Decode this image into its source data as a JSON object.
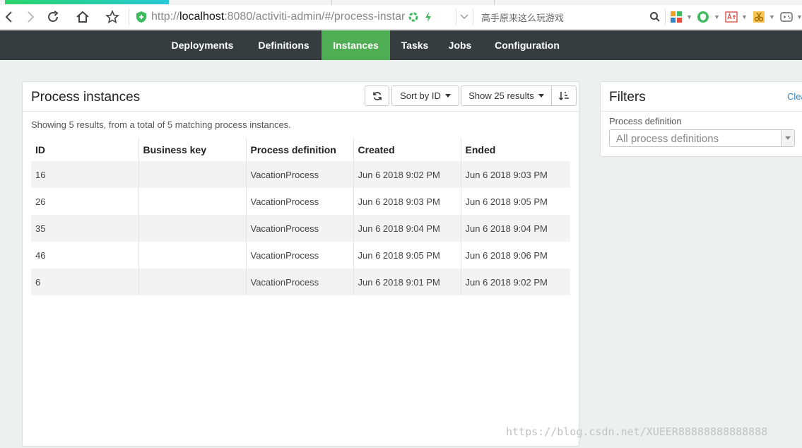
{
  "browser": {
    "url_scheme": "http://",
    "url_host": "localhost",
    "url_rest": ":8080/activiti-admin/#/process-instar",
    "search_hint": "高手原来这么玩游戏"
  },
  "nav": {
    "items": [
      {
        "label": "Deployments"
      },
      {
        "label": "Definitions"
      },
      {
        "label": "Instances"
      },
      {
        "label": "Tasks"
      },
      {
        "label": "Jobs"
      },
      {
        "label": "Configuration"
      }
    ],
    "active": "Instances"
  },
  "panel": {
    "title": "Process instances",
    "sort_label": "Sort by ID",
    "show_label": "Show 25 results",
    "summary": "Showing 5 results, from a total of 5 matching process instances.",
    "columns": [
      "ID",
      "Business key",
      "Process definition",
      "Created",
      "Ended"
    ],
    "rows": [
      {
        "id": "16",
        "business_key": "",
        "definition": "VacationProcess",
        "created": "Jun 6 2018 9:02 PM",
        "ended": "Jun 6 2018 9:03 PM"
      },
      {
        "id": "26",
        "business_key": "",
        "definition": "VacationProcess",
        "created": "Jun 6 2018 9:03 PM",
        "ended": "Jun 6 2018 9:05 PM"
      },
      {
        "id": "35",
        "business_key": "",
        "definition": "VacationProcess",
        "created": "Jun 6 2018 9:04 PM",
        "ended": "Jun 6 2018 9:04 PM"
      },
      {
        "id": "46",
        "business_key": "",
        "definition": "VacationProcess",
        "created": "Jun 6 2018 9:05 PM",
        "ended": "Jun 6 2018 9:06 PM"
      },
      {
        "id": "6",
        "business_key": "",
        "definition": "VacationProcess",
        "created": "Jun 6 2018 9:01 PM",
        "ended": "Jun 6 2018 9:02 PM"
      }
    ]
  },
  "filters": {
    "title": "Filters",
    "clear_label": "Clea",
    "process_definition_label": "Process definition",
    "process_definition_value": "All process definitions"
  },
  "watermark": "https://blog.csdn.net/XUEER88888888888888",
  "colors": {
    "nav_bg": "#353d3f",
    "nav_active": "#4fad53",
    "link": "#2e84c6"
  }
}
